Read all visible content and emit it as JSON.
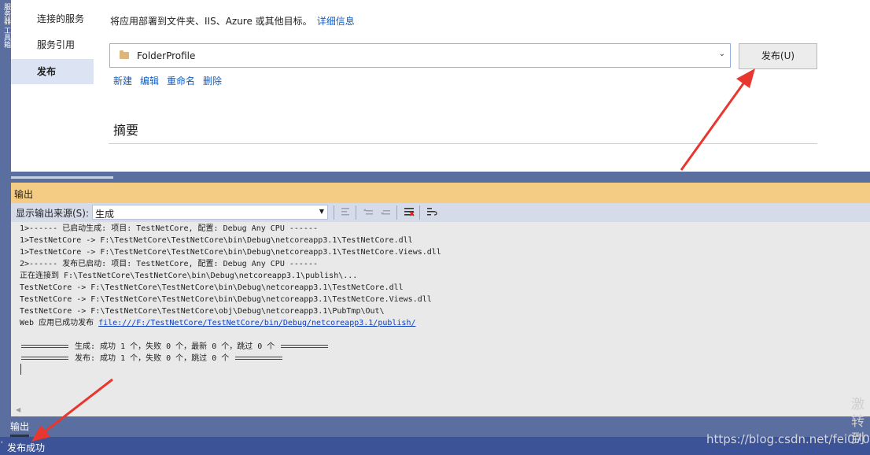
{
  "left_strip": {
    "text": "服务器 工具箱"
  },
  "nav": {
    "items": [
      {
        "label": "连接的服务"
      },
      {
        "label": "服务引用"
      },
      {
        "label": "发布"
      }
    ]
  },
  "publish": {
    "description": "将应用部署到文件夹、IIS、Azure 或其他目标。",
    "details_link": "详细信息",
    "profile_value": "FolderProfile",
    "publish_button": "发布(U)",
    "actions": {
      "new": "新建",
      "edit": "编辑",
      "rename": "重命名",
      "delete": "删除"
    },
    "summary_title": "摘要"
  },
  "output": {
    "title": "输出",
    "source_label": "显示输出来源(S):",
    "source_value": "生成",
    "lines": [
      "1>------ 已启动生成: 项目: TestNetCore, 配置: Debug Any CPU ------",
      "1>TestNetCore -> F:\\TestNetCore\\TestNetCore\\bin\\Debug\\netcoreapp3.1\\TestNetCore.dll",
      "1>TestNetCore -> F:\\TestNetCore\\TestNetCore\\bin\\Debug\\netcoreapp3.1\\TestNetCore.Views.dll",
      "2>------ 发布已启动: 项目: TestNetCore, 配置: Debug Any CPU ------",
      "正在连接到 F:\\TestNetCore\\TestNetCore\\bin\\Debug\\netcoreapp3.1\\publish\\...",
      "TestNetCore -> F:\\TestNetCore\\TestNetCore\\bin\\Debug\\netcoreapp3.1\\TestNetCore.dll",
      "TestNetCore -> F:\\TestNetCore\\TestNetCore\\bin\\Debug\\netcoreapp3.1\\TestNetCore.Views.dll",
      "TestNetCore -> F:\\TestNetCore\\TestNetCore\\obj\\Debug\\netcoreapp3.1\\PubTmp\\Out\\"
    ],
    "web_prefix": "Web 应用已成功发布 ",
    "web_link": "file:///F:/TestNetCore/TestNetCore/bin/Debug/netcoreapp3.1/publish/",
    "build_summary": " 生成: 成功 1 个，失败 0 个，最新 0 个，跳过 0 个 ",
    "publish_summary": " 发布: 成功 1 个，失败 0 个，跳过 0 个 "
  },
  "bottom_tab": "输出",
  "status": "发布成功",
  "watermark": "https://blog.csdn.net/fei0700",
  "watermark_partial": "激 转到"
}
